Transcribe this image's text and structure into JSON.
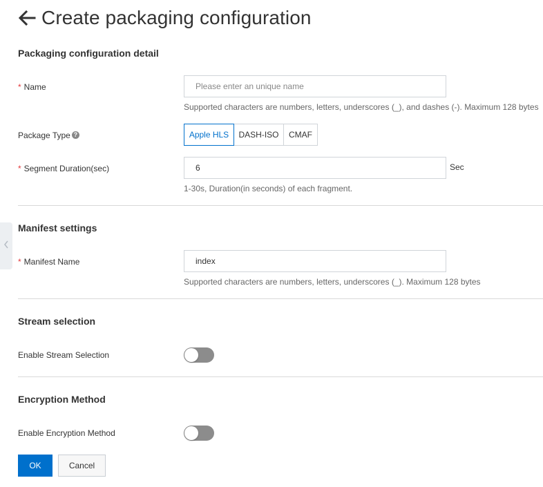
{
  "page": {
    "title": "Create packaging configuration",
    "back_icon": "arrow-left-icon"
  },
  "sections": {
    "detail": "Packaging configuration detail",
    "manifest": "Manifest settings",
    "stream": "Stream selection",
    "encryption": "Encryption Method"
  },
  "name_field": {
    "required_mark": "*",
    "label": "Name",
    "value": "",
    "placeholder": "Please enter an unique name",
    "help": "Supported characters are numbers, letters, underscores (_), and dashes (-). Maximum 128 bytes"
  },
  "package_type": {
    "label": "Package Type",
    "help_icon": "question-circle-icon",
    "help_icon_glyph": "?",
    "options": [
      "Apple HLS",
      "DASH-ISO",
      "CMAF"
    ],
    "selected": "Apple HLS"
  },
  "segment_duration": {
    "required_mark": "*",
    "label": "Segment Duration(sec)",
    "value": "6",
    "unit": "Sec",
    "help": "1-30s, Duration(in seconds) of each fragment."
  },
  "manifest_name": {
    "required_mark": "*",
    "label": "Manifest Name",
    "value": "index",
    "help": "Supported characters are numbers, letters, underscores (_). Maximum 128 bytes"
  },
  "stream_selection": {
    "label": "Enable Stream Selection",
    "enabled": false
  },
  "encryption": {
    "label": "Enable Encryption Method",
    "enabled": false
  },
  "actions": {
    "ok": "OK",
    "cancel": "Cancel"
  },
  "side_panel": {
    "icon": "chevron-left-icon"
  },
  "colors": {
    "primary": "#0070cc",
    "required": "#e4393c",
    "toggle_off": "#8c8c8c"
  }
}
